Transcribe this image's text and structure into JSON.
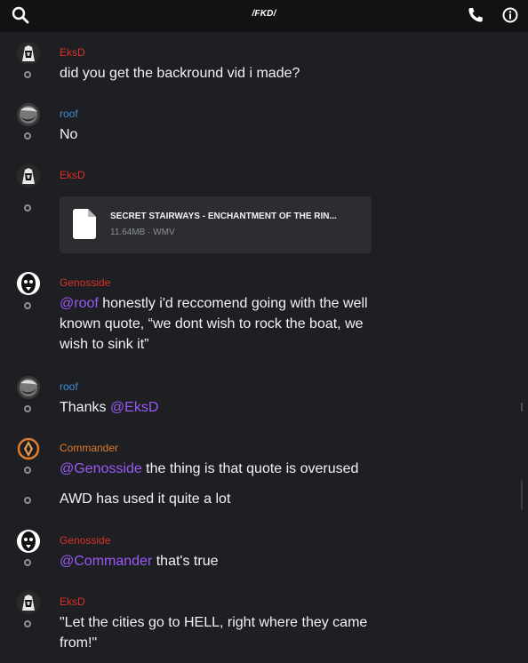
{
  "header": {
    "title": "/FKD/",
    "icons": [
      "search-icon",
      "phone-icon",
      "info-icon"
    ]
  },
  "colors": {
    "background": "#1e1f22",
    "topbar": "#111214",
    "mention": "#9b59f5",
    "eksd": "#d9302a",
    "roof": "#3b8fd4",
    "genosside": "#d9302a",
    "commander": "#e07b2c"
  },
  "messages": [
    {
      "author": "EksD",
      "text": "did you get the backround vid i made?"
    },
    {
      "author": "roof",
      "text": "No"
    },
    {
      "author": "EksD",
      "attachment": {
        "filename": "SECRET STAIRWAYS - ENCHANTMENT OF THE RIN...",
        "meta": "11.64MB · WMV"
      }
    },
    {
      "author": "Genosside",
      "mention": "@roof",
      "text": " honestly i'd reccomend going with the well known quote, “we dont wish to rock the boat, we wish to sink it”"
    },
    {
      "author": "roof",
      "text": "Thanks ",
      "mention": "@EksD"
    },
    {
      "author": "Commander",
      "mention": "@Genosside",
      "text": " the thing is that quote is overused"
    },
    {
      "author": "Commander",
      "text": "AWD has used it quite a lot"
    },
    {
      "author": "Genosside",
      "mention": "@Commander",
      "text": " that's true"
    },
    {
      "author": "EksD",
      "text": "\"Let the cities go to HELL, right where they came from!\""
    }
  ]
}
